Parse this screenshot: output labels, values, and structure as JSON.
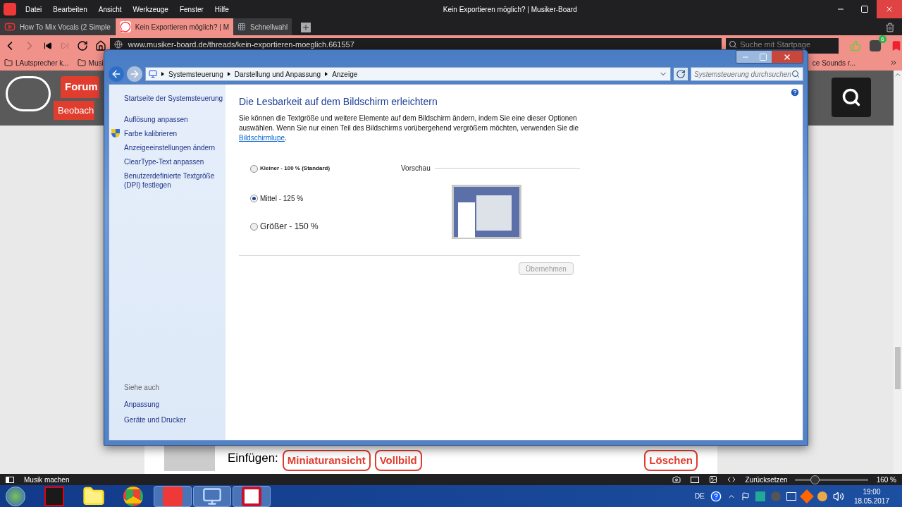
{
  "browser": {
    "menu": [
      "Datei",
      "Bearbeiten",
      "Ansicht",
      "Werkzeuge",
      "Fenster",
      "Hilfe"
    ],
    "title": "Kein Exportieren möglich? | Musiker-Board",
    "tabs": [
      {
        "label": "How To Mix Vocals (2 Simple",
        "selected": false,
        "kind": "video"
      },
      {
        "label": "Kein Exportieren möglich? | M",
        "selected": true,
        "kind": "forum"
      },
      {
        "label": "Schnellwahl",
        "selected": false,
        "kind": "grid"
      }
    ],
    "url": "www.musiker-board.de/threads/kein-exportieren-moeglich.661557",
    "search_placeholder": "Suche mit Startpage",
    "extension_badge": "6",
    "bookmarks": [
      "LAutsprecher k...",
      "Musi"
    ],
    "bookmarks_right": "ce Sounds r..."
  },
  "page": {
    "header_tabs": [
      "Forum",
      "Beobach"
    ],
    "insert_label": "Einfügen:",
    "insert_buttons": [
      "Miniaturansicht",
      "Vollbild"
    ],
    "delete_button": "Löschen"
  },
  "status_bar": {
    "page_title": "Musik machen",
    "reset": "Zurücksetzen",
    "zoom": {
      "level": 0.27
    },
    "zoom_reading": "160 %"
  },
  "dialog": {
    "breadcrumb": [
      "Systemsteuerung",
      "Darstellung und Anpassung",
      "Anzeige"
    ],
    "search_placeholder": "Systemsteuerung durchsuchen",
    "sidebar": {
      "home": "Startseite der Systemsteuerung",
      "tasks": [
        {
          "label": "Auflösung anpassen",
          "shield": false
        },
        {
          "label": "Farbe kalibrieren",
          "shield": true
        },
        {
          "label": "Anzeigeeinstellungen ändern",
          "shield": false
        },
        {
          "label": "ClearType-Text anpassen",
          "shield": false
        },
        {
          "label": "Benutzerdefinierte Textgröße (DPI) festlegen",
          "shield": false
        }
      ],
      "see_also_heading": "Siehe auch",
      "see_also": [
        "Anpassung",
        "Geräte und Drucker"
      ]
    },
    "heading": "Die Lesbarkeit auf dem Bildschirm erleichtern",
    "intro": "Sie können die Textgröße und weitere Elemente auf dem Bildschirm ändern, indem Sie eine dieser Optionen auswählen. Wenn Sie nur einen Teil des Bildschirms vorübergehend vergrößern möchten, verwenden Sie die",
    "intro_link": "Bildschirmlupe",
    "intro_after": ".",
    "options": [
      {
        "label": "Kleiner - 100 % (Standard)",
        "selected": false,
        "kind": "small"
      },
      {
        "label": "Mittel - 125 %",
        "selected": true,
        "kind": "medium"
      },
      {
        "label": "Größer - 150 %",
        "selected": false,
        "kind": "large"
      }
    ],
    "preview_label": "Vorschau",
    "apply_button": {
      "label": "Übernehmen",
      "disabled": true
    }
  },
  "taskbar": {
    "apps": [
      {
        "kind": "pdf",
        "active": false
      },
      {
        "kind": "folder",
        "active": false
      },
      {
        "kind": "chrome",
        "active": false
      },
      {
        "kind": "vivaldi",
        "active": true
      },
      {
        "kind": "control",
        "active": true
      },
      {
        "kind": "cubase",
        "active": true
      }
    ],
    "language": "DE",
    "time": "19:00",
    "date": "18.05.2017"
  }
}
